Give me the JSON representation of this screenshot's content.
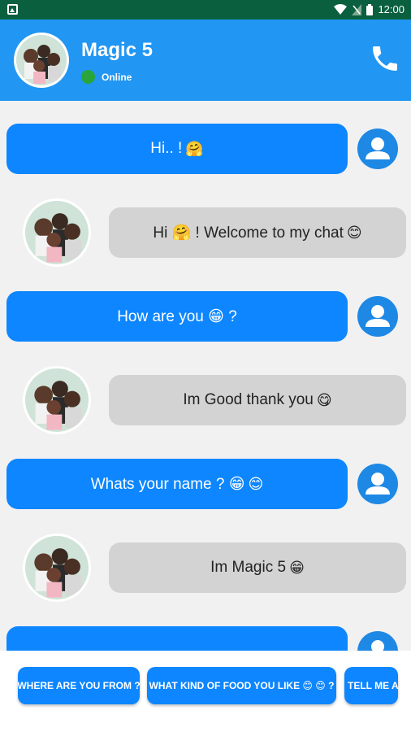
{
  "status_bar": {
    "time": "12:00"
  },
  "header": {
    "title": "Magic 5",
    "status": "Online"
  },
  "messages": [
    {
      "from": "user",
      "text": "Hi.. !",
      "emoji": "🤗"
    },
    {
      "from": "bot",
      "text": "Hi 🤗 ! Welcome to my chat",
      "emoji": "😊"
    },
    {
      "from": "user",
      "text": "How are you 😁 ?",
      "emoji": ""
    },
    {
      "from": "bot",
      "text": "Im Good thank you",
      "emoji": "😋"
    },
    {
      "from": "user",
      "text": "Whats your name ? 😁",
      "emoji": "😊"
    },
    {
      "from": "bot",
      "text": "Im Magic 5",
      "emoji": "😁"
    },
    {
      "from": "user",
      "text": "",
      "emoji": ""
    }
  ],
  "suggestions": [
    "WHERE ARE YOU FROM ?",
    "WHAT KIND OF FOOD YOU LIKE 😊 😊 ?",
    "TELL ME A"
  ],
  "colors": {
    "status_bar": "#0a5f3f",
    "app_bar": "#2196f3",
    "user_bubble": "#0d86ff",
    "bot_bubble": "#d3d3d3",
    "online": "#2aa53a"
  }
}
